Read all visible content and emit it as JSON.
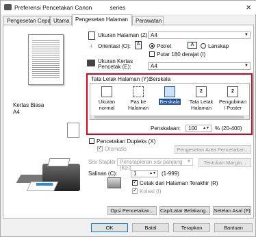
{
  "window": {
    "title": "Preferensi Pencetakan Canon",
    "title_suffix": "series",
    "close": "×"
  },
  "tabs": [
    "Pengesetan Cepat",
    "Utama",
    "Pengesetan Halaman",
    "Perawatan"
  ],
  "preview": {
    "media_type": "Kertas Biasa",
    "paper_size": "A4"
  },
  "page_size": {
    "label": "Ukuran Halaman (Z):",
    "value": "A4"
  },
  "orientation": {
    "label": "Orientasi (O):",
    "portrait": "Potret",
    "landscape": "Lanskap",
    "rotate": "Putar 180 derajat (I)"
  },
  "printer_paper": {
    "label": "Ukuran Kertas Pencetak (E):",
    "value": "A4"
  },
  "layout": {
    "label": "Tata Letak Halaman (Y):",
    "value": "Berskala",
    "items": [
      "Ukuran normal",
      "Pas ke Halaman",
      "Berskala",
      "Tata Letak Halaman",
      "Pengubinan / Poster"
    ],
    "scale_label": "Penskalaan:",
    "scale_value": "100",
    "scale_range": "% (20-400)"
  },
  "duplex": {
    "label": "Pencetakan Dupleks (X)",
    "auto": "Otomatis",
    "area_btn": "Pengesetan Area Pencetakan..."
  },
  "stapler": {
    "label": "Sisi Stapler (L):",
    "value": "Penstapleran sisi panjang (Kiri)",
    "margin_btn": "Tentukan Margin..."
  },
  "copies": {
    "label": "Salinan (C):",
    "value": "1",
    "range": "(1-999)",
    "last_first": "Cetak dari Halaman Terakhir (R)",
    "collate": "Kolasi (I)"
  },
  "bottom_buttons": [
    "Opsi Pencetakan...",
    "Cap/Latar Belakang...",
    "Setelan Asal (F)"
  ],
  "dialog_buttons": [
    "OK",
    "Batal",
    "Terapkan",
    "Bantuan"
  ],
  "accent": "#e0001b"
}
